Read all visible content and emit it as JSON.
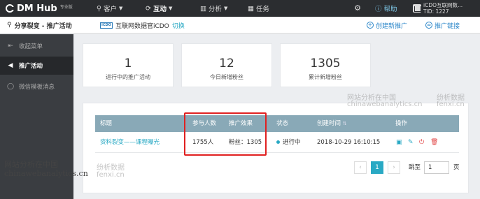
{
  "topnav": {
    "logo": "DM Hub",
    "edition": "专业版",
    "items": [
      {
        "label": "客户",
        "icon": "person-icon"
      },
      {
        "label": "互动",
        "icon": "refresh-icon"
      },
      {
        "label": "分析",
        "icon": "bar-chart-icon"
      },
      {
        "label": "任务",
        "icon": "grid-icon"
      }
    ],
    "help": "帮助",
    "user_name": "iCDO互联网数...",
    "tid": "TID: 1227"
  },
  "subbar": {
    "breadcrumb": "分享裂变 - 推广活动",
    "org_logo": "ICDO",
    "org_name": "互联网数据官iCDO",
    "switch": "切换",
    "create": "创建新推广",
    "link": "推广链接"
  },
  "sidebar": {
    "items": [
      {
        "label": "收起菜单",
        "icon": "collapse-icon"
      },
      {
        "label": "推广活动",
        "icon": "megaphone-icon"
      },
      {
        "label": "微信模板消息",
        "icon": "chat-icon"
      }
    ]
  },
  "stats": [
    {
      "value": "1",
      "label": "进行中的推广活动"
    },
    {
      "value": "12",
      "label": "今日新增粉丝"
    },
    {
      "value": "1305",
      "label": "累计新增粉丝"
    }
  ],
  "table": {
    "headers": [
      "标题",
      "参与人数",
      "推广效果",
      "状态",
      "创建时间",
      "操作"
    ],
    "rows": [
      {
        "title": "资料裂变——课程曝光",
        "participants": "1755人",
        "effect": "粉丝：1305",
        "status": "进行中",
        "created": "2018-10-29 16:10:15"
      }
    ]
  },
  "pager": {
    "prev": "‹",
    "page": "1",
    "next": "›",
    "jump_label": "跳至",
    "jump_value": "1",
    "page_unit": "页"
  },
  "watermarks": {
    "cn1": "网站分析在中国",
    "en1": "chinawebanalytics.cn",
    "cn2": "网站分析在中国",
    "en2": "chinawebanalytics.cn",
    "fx1": "纷析数据",
    "fx1_en": "fenxi.cn",
    "fx2": "纷析数据",
    "fx2_en": "fenxi.cn"
  },
  "colors": {
    "accent": "#29a9c4",
    "header_bg": "#2b2d30",
    "table_head": "#89a9b7",
    "highlight": "#e02020"
  }
}
